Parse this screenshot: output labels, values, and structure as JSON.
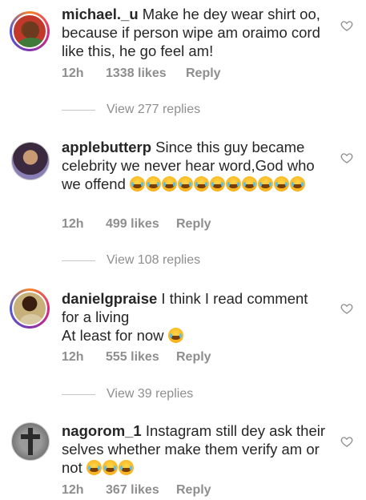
{
  "comments": [
    {
      "username": "michael._u",
      "text": "Make he dey wear shirt oo, because if person wipe am oraimo cord like this, he go feel am!",
      "emoji_count": 0,
      "time": "12h",
      "likes": "1338 likes",
      "reply": "Reply",
      "replies": "View 277 replies"
    },
    {
      "username": "applebutterp",
      "text": "Since this guy became celebrity we never hear word,God who we offend",
      "emoji_count": 11,
      "time": "12h",
      "likes": "499 likes",
      "reply": "Reply",
      "replies": "View 108 replies"
    },
    {
      "username": "danielgpraise",
      "text": "I think I read comment for a living",
      "text2": "At least for now",
      "emoji_count": 1,
      "time": "12h",
      "likes": "555 likes",
      "reply": "Reply",
      "replies": "View 39 replies"
    },
    {
      "username": "nagorom_1",
      "text": "Instagram still dey ask their selves whether make them verify am or not",
      "emoji_count": 3,
      "time": "12h",
      "likes": "367 likes",
      "reply": "Reply"
    }
  ],
  "icons": {
    "like": "heart-outline-icon",
    "emoji": "face-with-tears-of-joy"
  },
  "colors": {
    "text": "#262626",
    "meta": "#8e8e8e",
    "divider": "#c7c7c7"
  }
}
